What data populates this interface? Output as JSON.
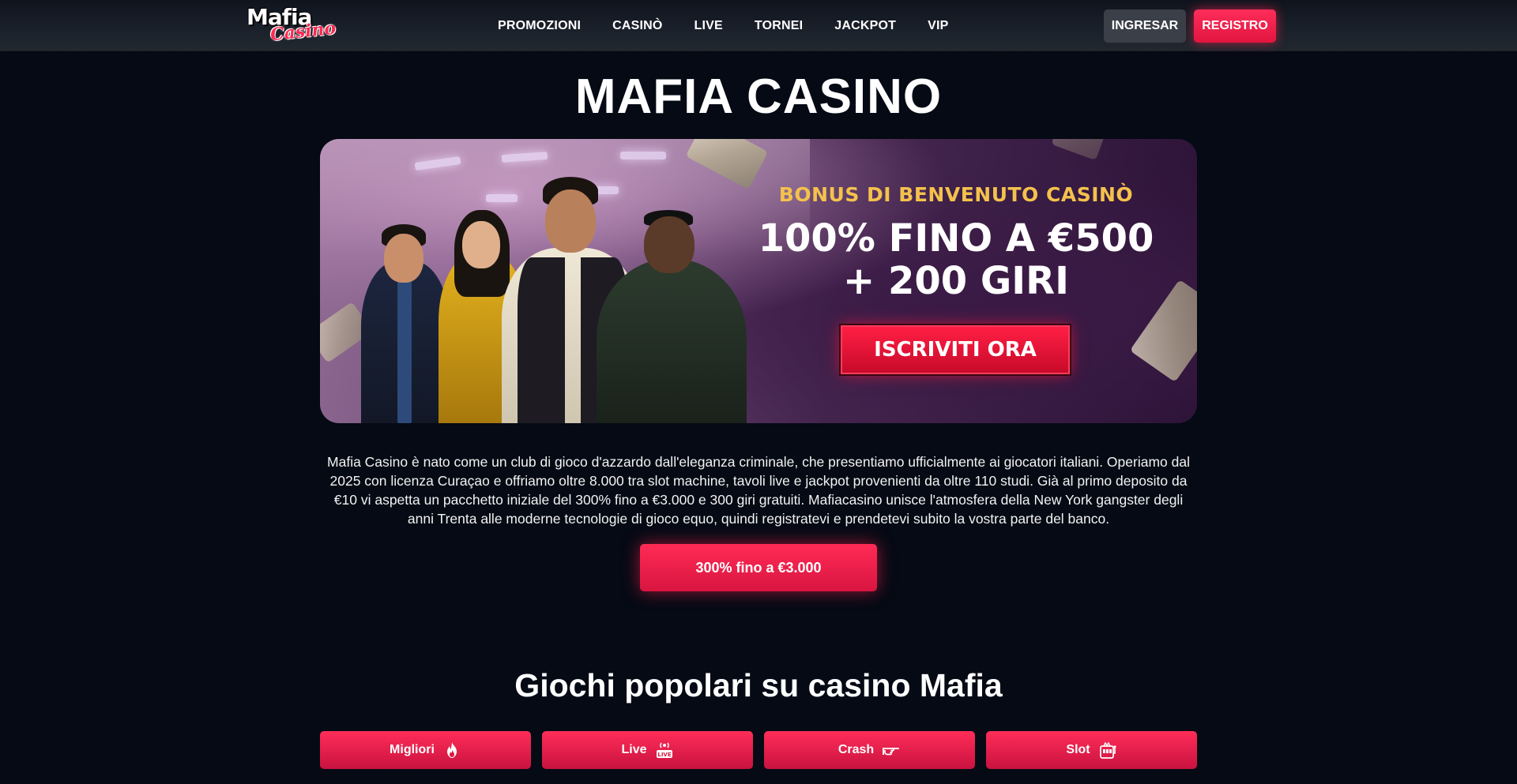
{
  "header": {
    "logo_word": "Mafia",
    "logo_script": "Casino",
    "nav": [
      "PROMOZIONI",
      "CASINÒ",
      "LIVE",
      "TORNEI",
      "JACKPOT",
      "VIP"
    ],
    "login_label": "INGRESAR",
    "register_label": "REGISTRO"
  },
  "hero": {
    "title": "MAFIA CASINO"
  },
  "banner": {
    "eyebrow": "BONUS DI BENVENUTO CASINÒ",
    "line1": "100% FINO A €500",
    "line2": "+ 200 GIRI",
    "cta_label": "ISCRIVITI ORA"
  },
  "description": "Mafia Casino è nato come un club di gioco d'azzardo dall'eleganza criminale, che presentiamo ufficialmente ai giocatori italiani. Operiamo dal 2025 con licenza Curaçao e offriamo oltre 8.000 tra slot machine, tavoli live e jackpot provenienti da oltre 110 studi. Già al primo deposito da €10 vi aspetta un pacchetto iniziale del 300% fino a €3.000 e 300 giri gratuiti. Mafiacasino unisce l'atmosfera della New York gangster degli anni Trenta alle moderne tecnologie di gioco equo, quindi registratevi e prendetevi subito la vostra parte del banco.",
  "main_cta_label": "300% fino a €3.000",
  "games": {
    "title": "Giochi popolari su casino Mafia",
    "tabs": [
      {
        "label": "Migliori",
        "icon": "flame-icon"
      },
      {
        "label": "Live",
        "icon": "live-broadcast-icon"
      },
      {
        "label": "Crash",
        "icon": "pointing-hand-icon"
      },
      {
        "label": "Slot",
        "icon": "slot-machine-icon"
      }
    ]
  },
  "colors": {
    "background": "#050a14",
    "accent_red": "#ff2b55",
    "gold": "#f4c24c",
    "header_button_grey": "#3a3f48"
  }
}
